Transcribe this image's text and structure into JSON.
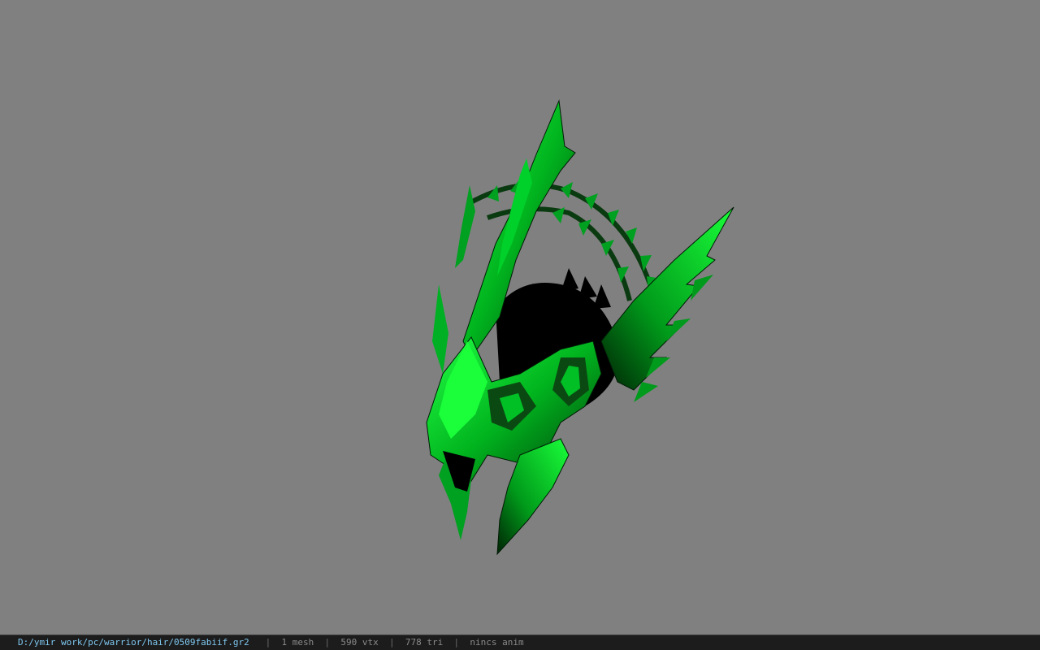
{
  "viewer": {
    "background_color": "#808080",
    "model_color": "#00cc22",
    "model_shadow_color": "#000000"
  },
  "statusbar": {
    "file_path": "D:/ymir work/pc/warrior/hair/0509fabiif.gr2",
    "separator": "|",
    "mesh_count": "1 mesh",
    "vertex_count": "590 vtx",
    "triangle_count": "778 tri",
    "anim_status": "nincs anim"
  }
}
